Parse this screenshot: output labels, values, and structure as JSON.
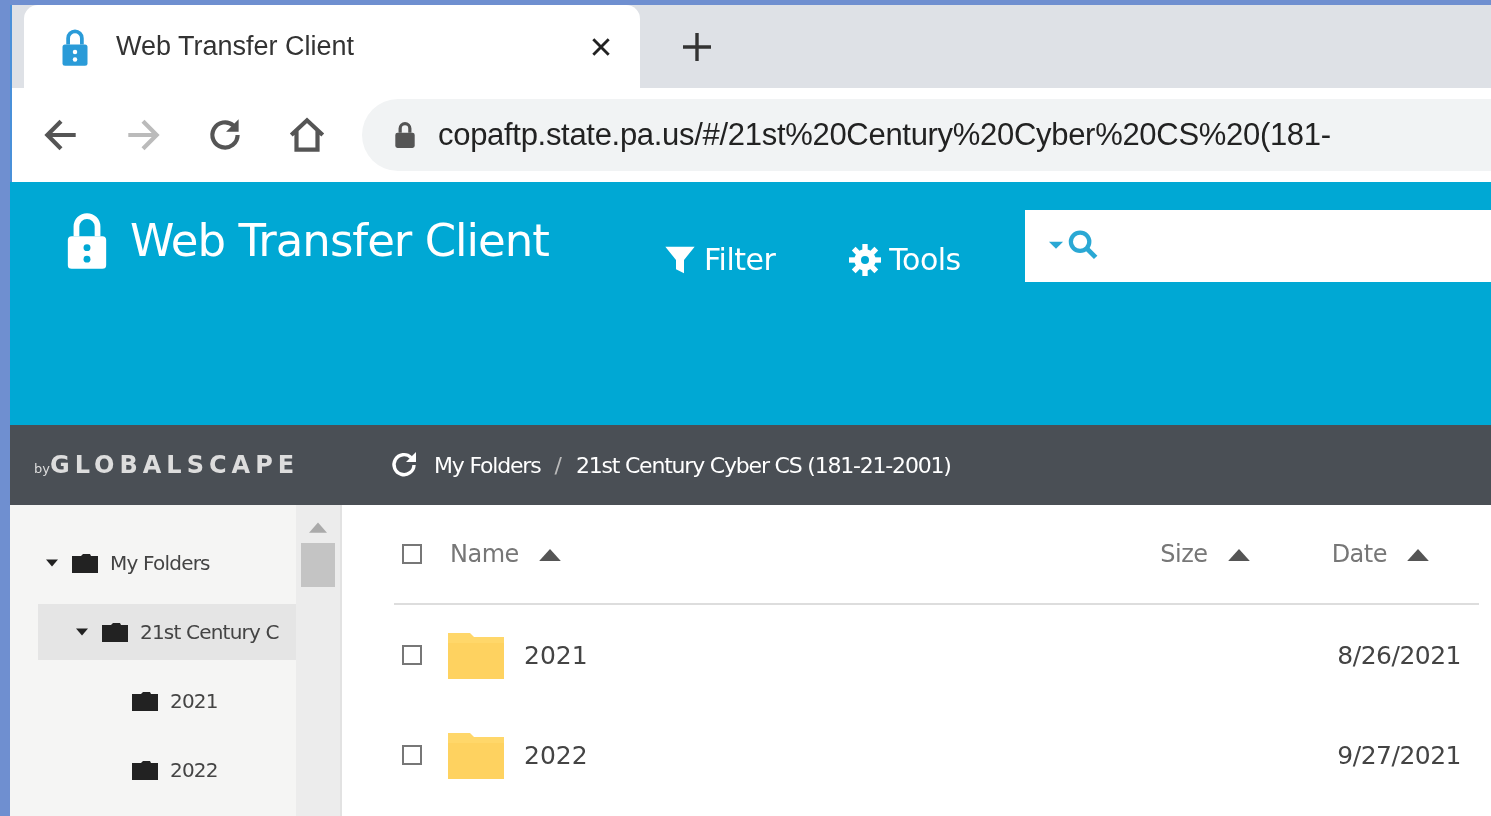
{
  "browser": {
    "tab_title": "Web Transfer Client",
    "url": "copaftp.state.pa.us/#/21st%20Century%20Cyber%20CS%20(181-"
  },
  "header": {
    "title": "Web Transfer Client",
    "menu": [
      {
        "kind": "filter",
        "label": "Filter"
      },
      {
        "kind": "tools",
        "label": "Tools"
      }
    ]
  },
  "logo": {
    "prefix": "by",
    "name": "GLOBALSCAPE"
  },
  "breadcrumb": {
    "separator": "/",
    "items": [
      "My Folders",
      "21st Century Cyber CS (181-21-2001)"
    ]
  },
  "tree": [
    {
      "label": "My Folders",
      "expanded": true,
      "selected": false,
      "children": [
        {
          "label": "21st Century C",
          "expanded": true,
          "selected": true,
          "children": [
            {
              "label": "2021",
              "selected": false
            },
            {
              "label": "2022",
              "selected": false
            }
          ]
        }
      ]
    }
  ],
  "table": {
    "select_all": {
      "checked": false
    },
    "columns": [
      "Name",
      "Size",
      "Date"
    ],
    "rows": [
      {
        "name": "2021",
        "date": "8/26/2021",
        "checked": false
      },
      {
        "name": "2022",
        "date": "9/27/2021",
        "checked": false
      }
    ]
  }
}
